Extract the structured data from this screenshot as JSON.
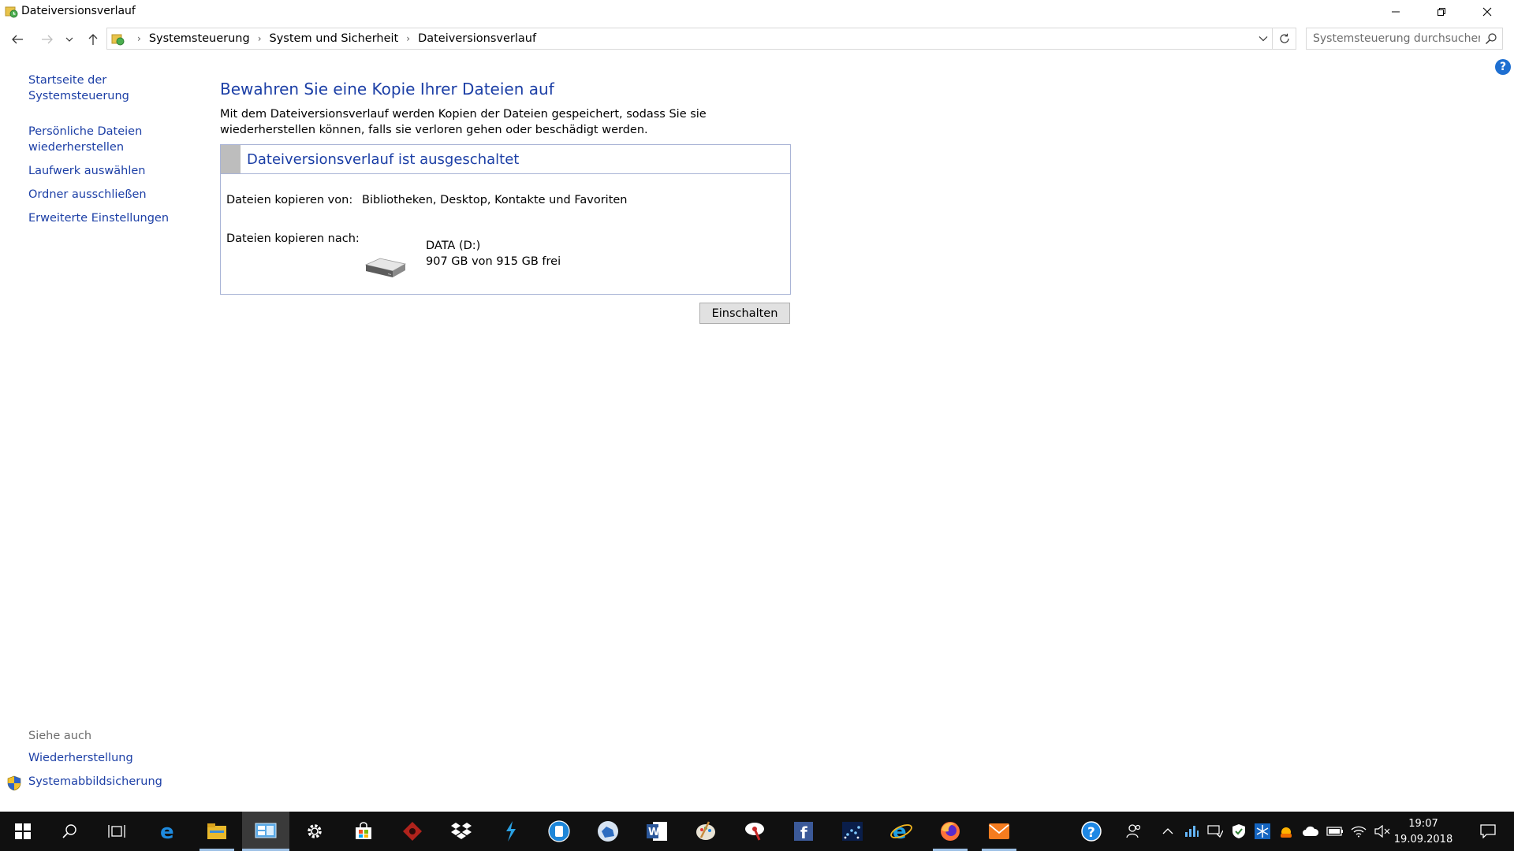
{
  "window": {
    "title": "Dateiversionsverlauf"
  },
  "address": {
    "breadcrumbs": [
      "Systemsteuerung",
      "System und Sicherheit",
      "Dateiversionsverlauf"
    ]
  },
  "search": {
    "placeholder": "Systemsteuerung durchsuchen"
  },
  "help": {
    "label": "?"
  },
  "sidebar": {
    "links": [
      "Startseite der Systemsteuerung",
      "Persönliche Dateien wiederherstellen",
      "Laufwerk auswählen",
      "Ordner ausschließen",
      "Erweiterte Einstellungen"
    ],
    "see_also": {
      "header": "Siehe auch",
      "links": [
        "Wiederherstellung",
        "Systemabbildsicherung"
      ]
    }
  },
  "main": {
    "title": "Bewahren Sie eine Kopie Ihrer Dateien auf",
    "description": "Mit dem Dateiversionsverlauf werden Kopien der Dateien gespeichert, sodass Sie sie wiederherstellen können, falls sie verloren gehen oder beschädigt werden.",
    "status_title": "Dateiversionsverlauf ist ausgeschaltet",
    "copy_from_label": "Dateien kopieren von:",
    "copy_from_value": "Bibliotheken, Desktop, Kontakte und Favoriten",
    "copy_to_label": "Dateien kopieren nach:",
    "drive_name": "DATA (D:)",
    "drive_free": "907 GB von 915 GB frei",
    "turn_on_button": "Einschalten"
  },
  "taskbar": {
    "clock_time": "19:07",
    "clock_date": "19.09.2018",
    "pinned": [
      "start-icon",
      "search-icon",
      "task-view-icon",
      "edge-icon",
      "file-explorer-icon",
      "control-panel-icon",
      "settings-icon",
      "store-icon",
      "game-icon",
      "dropbox-icon",
      "visual-studio-code-icon",
      "bluetooth-app-icon",
      "photo-app-icon",
      "word-icon",
      "paint-app-icon",
      "remote-app-icon",
      "facebook-icon",
      "network-app-icon",
      "internet-explorer-icon",
      "firefox-icon",
      "mail-icon"
    ]
  },
  "colors": {
    "link_blue": "#1c3fa6",
    "taskbar_bg": "#101010",
    "status_swatch": "#bdbdbd"
  }
}
